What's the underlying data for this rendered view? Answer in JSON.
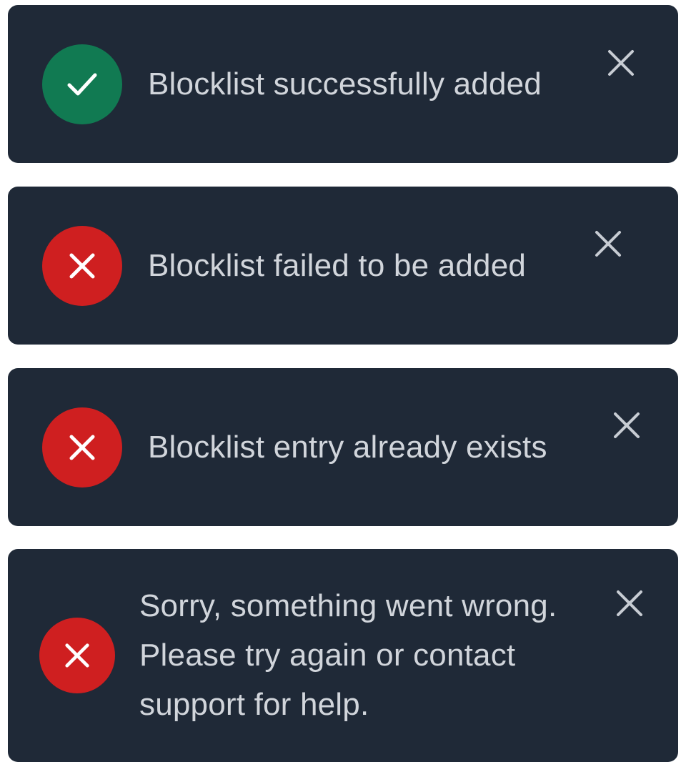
{
  "toasts": [
    {
      "status": "success",
      "status_icon": "check-icon",
      "status_color": "#117a52",
      "message": "Blocklist successfully added",
      "close_icon": "close-icon"
    },
    {
      "status": "error",
      "status_icon": "x-icon",
      "status_color": "#cf1f20",
      "message": "Blocklist failed to be added",
      "close_icon": "close-icon"
    },
    {
      "status": "error",
      "status_icon": "x-icon",
      "status_color": "#cf1f20",
      "message": "Blocklist entry already exists",
      "close_icon": "close-icon"
    },
    {
      "status": "error",
      "status_icon": "x-icon",
      "status_color": "#cf1f20",
      "message": "Sorry, something went wrong.\nPlease try again or contact\nsupport for help.",
      "close_icon": "close-icon"
    }
  ],
  "colors": {
    "toast_background": "#1f2937",
    "text": "#d1d5db",
    "close_icon": "#c7ccd3",
    "icon_glyph": "#ffffff"
  }
}
